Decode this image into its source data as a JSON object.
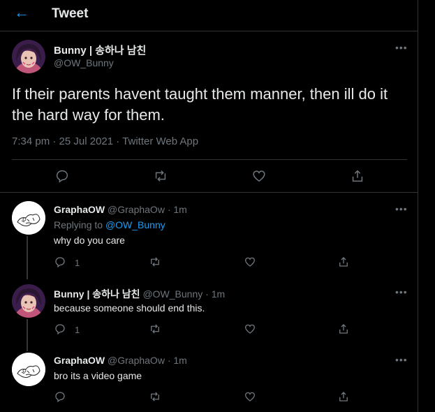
{
  "header": {
    "title": "Tweet",
    "back_icon": "arrow-left-icon"
  },
  "main_tweet": {
    "author_name": "Bunny | 송하나 남친",
    "handle": "@OW_Bunny",
    "text": "If their parents havent taught them manner, then ill do it the hard way for them.",
    "meta": "7:34 pm · 25 Jul 2021 · Twitter Web App"
  },
  "replies": [
    {
      "author_name": "GraphaOW",
      "handle": "@GraphaOw",
      "time": "· 1m",
      "replying_prefix": "Replying to",
      "replying_to": "@OW_Bunny",
      "text": "why do you care",
      "reply_count": "1"
    },
    {
      "author_name": "Bunny | 송하나 남친",
      "handle": "@OW_Bunny",
      "time": "· 1m",
      "text": "because someone should end this.",
      "reply_count": "1"
    },
    {
      "author_name": "GraphaOW",
      "handle": "@GraphaOw",
      "time": "· 1m",
      "text": "bro its a video game",
      "reply_count": ""
    }
  ],
  "colors": {
    "accent": "#1d9bf0",
    "muted": "#6e767d",
    "border": "#2f3336",
    "background": "#000000"
  }
}
